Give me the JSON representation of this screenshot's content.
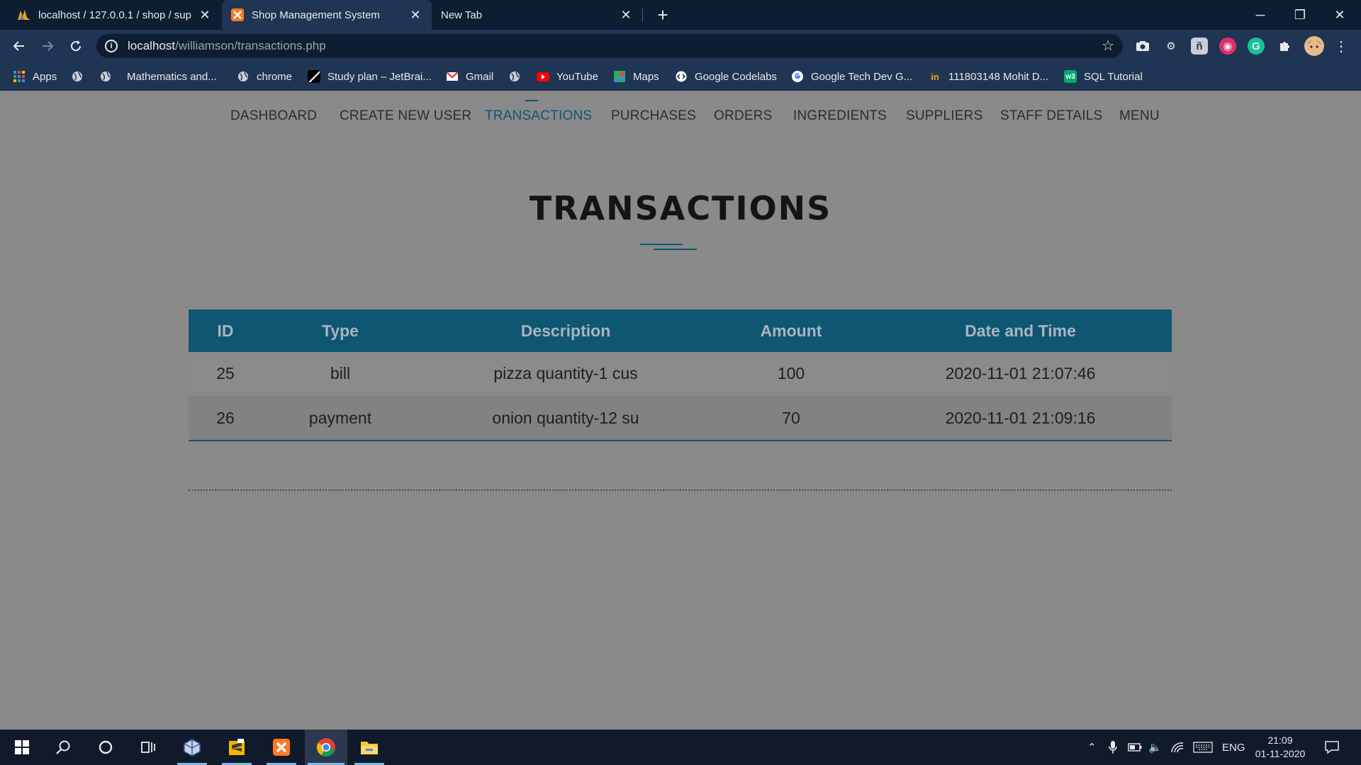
{
  "browser": {
    "tabs": [
      {
        "title": "localhost / 127.0.0.1 / shop / sup",
        "icon": "phpmyadmin-icon",
        "active": false
      },
      {
        "title": "Shop Management System",
        "icon": "xampp-icon",
        "active": true
      },
      {
        "title": "New Tab",
        "icon": "",
        "active": false
      }
    ],
    "url_host": "localhost",
    "url_path": "/williamson/transactions.php",
    "bookmarks": [
      {
        "label": "Apps",
        "icon": "apps-grid-icon"
      },
      {
        "label": "",
        "icon": "globe-icon"
      },
      {
        "label": "",
        "icon": "globe-icon"
      },
      {
        "label": "Mathematics and...",
        "icon": ""
      },
      {
        "label": "chrome",
        "icon": "globe-icon"
      },
      {
        "label": "Study plan – JetBrai...",
        "icon": "jetbrains-icon"
      },
      {
        "label": "Gmail",
        "icon": "gmail-icon"
      },
      {
        "label": "",
        "icon": "globe-icon"
      },
      {
        "label": "YouTube",
        "icon": "youtube-icon"
      },
      {
        "label": "Maps",
        "icon": "maps-icon"
      },
      {
        "label": "Google Codelabs",
        "icon": "codelabs-icon"
      },
      {
        "label": "Google Tech Dev G...",
        "icon": "google-icon"
      },
      {
        "label": "111803148 Mohit D...",
        "icon": "folder-icon"
      },
      {
        "label": "SQL Tutorial",
        "icon": "w3schools-icon"
      }
    ]
  },
  "nav": {
    "items": [
      "DASHBOARD",
      "CREATE NEW USER",
      "TRANSACTIONS",
      "PURCHASES",
      "ORDERS",
      "INGREDIENTS",
      "SUPPLIERS",
      "STAFF DETAILS",
      "MENU"
    ],
    "active": "TRANSACTIONS"
  },
  "page": {
    "title": "TRANSACTIONS"
  },
  "table": {
    "headers": [
      "ID",
      "Type",
      "Description",
      "Amount",
      "Date and Time"
    ],
    "rows": [
      [
        "25",
        "bill",
        "pizza quantity-1 cus",
        "100",
        "2020-11-01 21:07:46"
      ],
      [
        "26",
        "payment",
        "onion quantity-12 su",
        "70",
        "2020-11-01 21:09:16"
      ]
    ]
  },
  "taskbar": {
    "language": "ENG",
    "time": "21:09",
    "date": "01-11-2020"
  },
  "colors": {
    "accent": "#0f5673",
    "page_bg": "#8a8a8a",
    "chrome_dark": "#0d1e33",
    "chrome_toolbar": "#1f3553"
  }
}
